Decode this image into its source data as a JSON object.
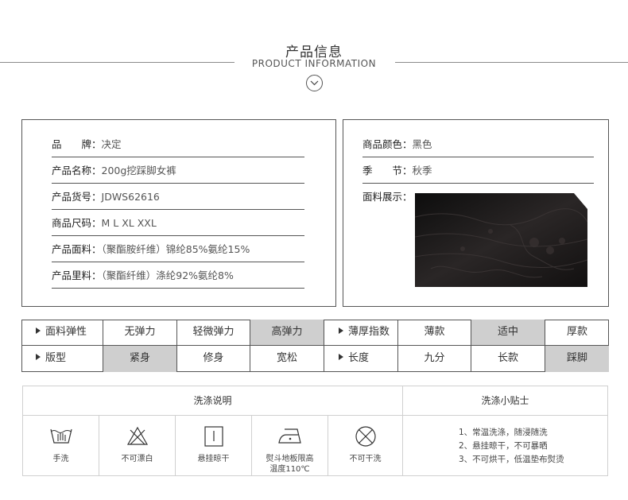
{
  "header": {
    "title_cn": "产品信息",
    "title_en": "PRODUCT INFORMATION"
  },
  "left_info": [
    {
      "label": "品　　牌：",
      "value": "决定"
    },
    {
      "label": "产品名称：",
      "value": "200g挖踩脚女裤"
    },
    {
      "label": "产品货号：",
      "value": "JDWS62616"
    },
    {
      "label": "商品尺码：",
      "value": "M  L  XL  XXL"
    },
    {
      "label": "产品面料：",
      "value": "（聚酯胺纤维）锦纶85%氨纶15%"
    },
    {
      "label": "产品里料：",
      "value": "（聚酯纤维）涤纶92%氨纶8%"
    }
  ],
  "right_info": [
    {
      "label": "商品颜色：",
      "value": "黑色"
    },
    {
      "label": "季　　节：",
      "value": "秋季"
    },
    {
      "label": "面料展示：",
      "value": ""
    }
  ],
  "attributes": {
    "row1": [
      "面料弹性",
      "无弹力",
      "轻微弹力",
      "高弹力",
      "薄厚指数",
      "薄款",
      "适中",
      "厚款"
    ],
    "row2": [
      "版型",
      "紧身",
      "修身",
      "宽松",
      "长度",
      "九分",
      "长款",
      "踩脚"
    ]
  },
  "wash": {
    "title": "洗涤说明",
    "tips_title": "洗涤小贴士",
    "items": [
      {
        "icon": "hand-wash-icon",
        "label": "手洗"
      },
      {
        "icon": "no-bleach-icon",
        "label": "不可漂白"
      },
      {
        "icon": "hang-dry-icon",
        "label": "悬挂晾干"
      },
      {
        "icon": "iron-icon",
        "label": "熨斗地板限高温度110℃"
      },
      {
        "icon": "no-dry-clean-icon",
        "label": "不可干洗"
      }
    ],
    "tips": [
      "1、常温洗涤，随浸随洗",
      "2、悬挂晾干，不可暴晒",
      "3、不可烘干，低温垫布熨烫"
    ]
  },
  "colors": {
    "highlight": "#cfcfcf",
    "border": "#555555",
    "fabric": "#1a1a1a"
  }
}
